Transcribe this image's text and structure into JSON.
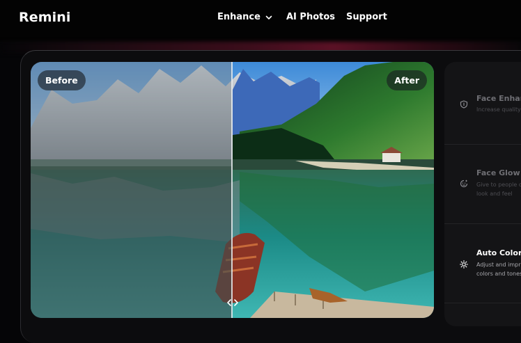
{
  "header": {
    "logo": "Remini",
    "nav": [
      {
        "label": "Enhance",
        "icon": "chevron-down-icon"
      },
      {
        "label": "AI Photos"
      },
      {
        "label": "Support"
      }
    ]
  },
  "comparison": {
    "before_label": "Before",
    "after_label": "After",
    "divider_position": 0.5,
    "handle_icon": "left-right-arrows-icon"
  },
  "features": [
    {
      "title": "Face Enhance",
      "desc_lines": [
        "Increase quality"
      ],
      "icon": "shield-icon",
      "active": false
    },
    {
      "title": "Face Glow",
      "desc_lines": [
        "Give to people c",
        "look and feel"
      ],
      "icon": "face-glow-icon",
      "active": false
    },
    {
      "title": "Auto Color",
      "desc_lines": [
        "Adjust and impr",
        "colors and tones"
      ],
      "icon": "sun-icon",
      "active": true
    }
  ],
  "colors": {
    "background": "#050507",
    "panel": "#0c0c0e",
    "sidebar": "#141416",
    "accent_glow": "#5a1125"
  }
}
